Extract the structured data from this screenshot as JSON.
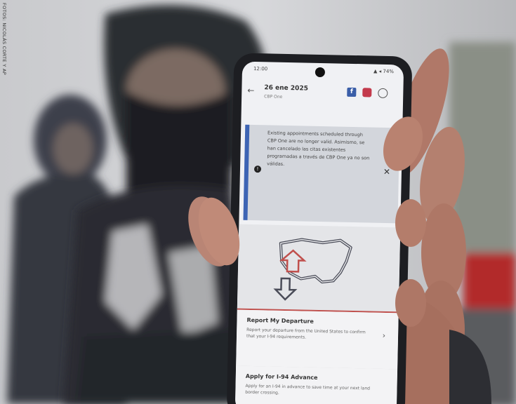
{
  "credit": "FOTOS: NICOLÁS CORTE Y AP",
  "phone": {
    "status_time": "12:00",
    "status_icons": "▲ ◂ 74%",
    "date": "26 ene 2025",
    "sub": "CBP One",
    "facebook_letter": "f",
    "alert_text": "Existing appointments scheduled through CBP One are no longer valid. Asimismo, se han cancelado las citas existentes programadas a través de CBP One ya no son válidas.",
    "close": "✕",
    "back": "←",
    "card1": {
      "title": "Report My Departure",
      "desc": "Report your departure from the United States to confirm that your I-94 requirements.",
      "chev": "›"
    },
    "card2": {
      "title": "Apply for I-94 Advance",
      "desc": "Apply for an I-94 in advance to save time at your next land border crossing.",
      "chev": ""
    }
  },
  "colors": {
    "accent_blue": "#3d64b4",
    "map_red": "#c0504d",
    "facebook": "#3a5ea8",
    "instagram": "#c33a4c"
  }
}
